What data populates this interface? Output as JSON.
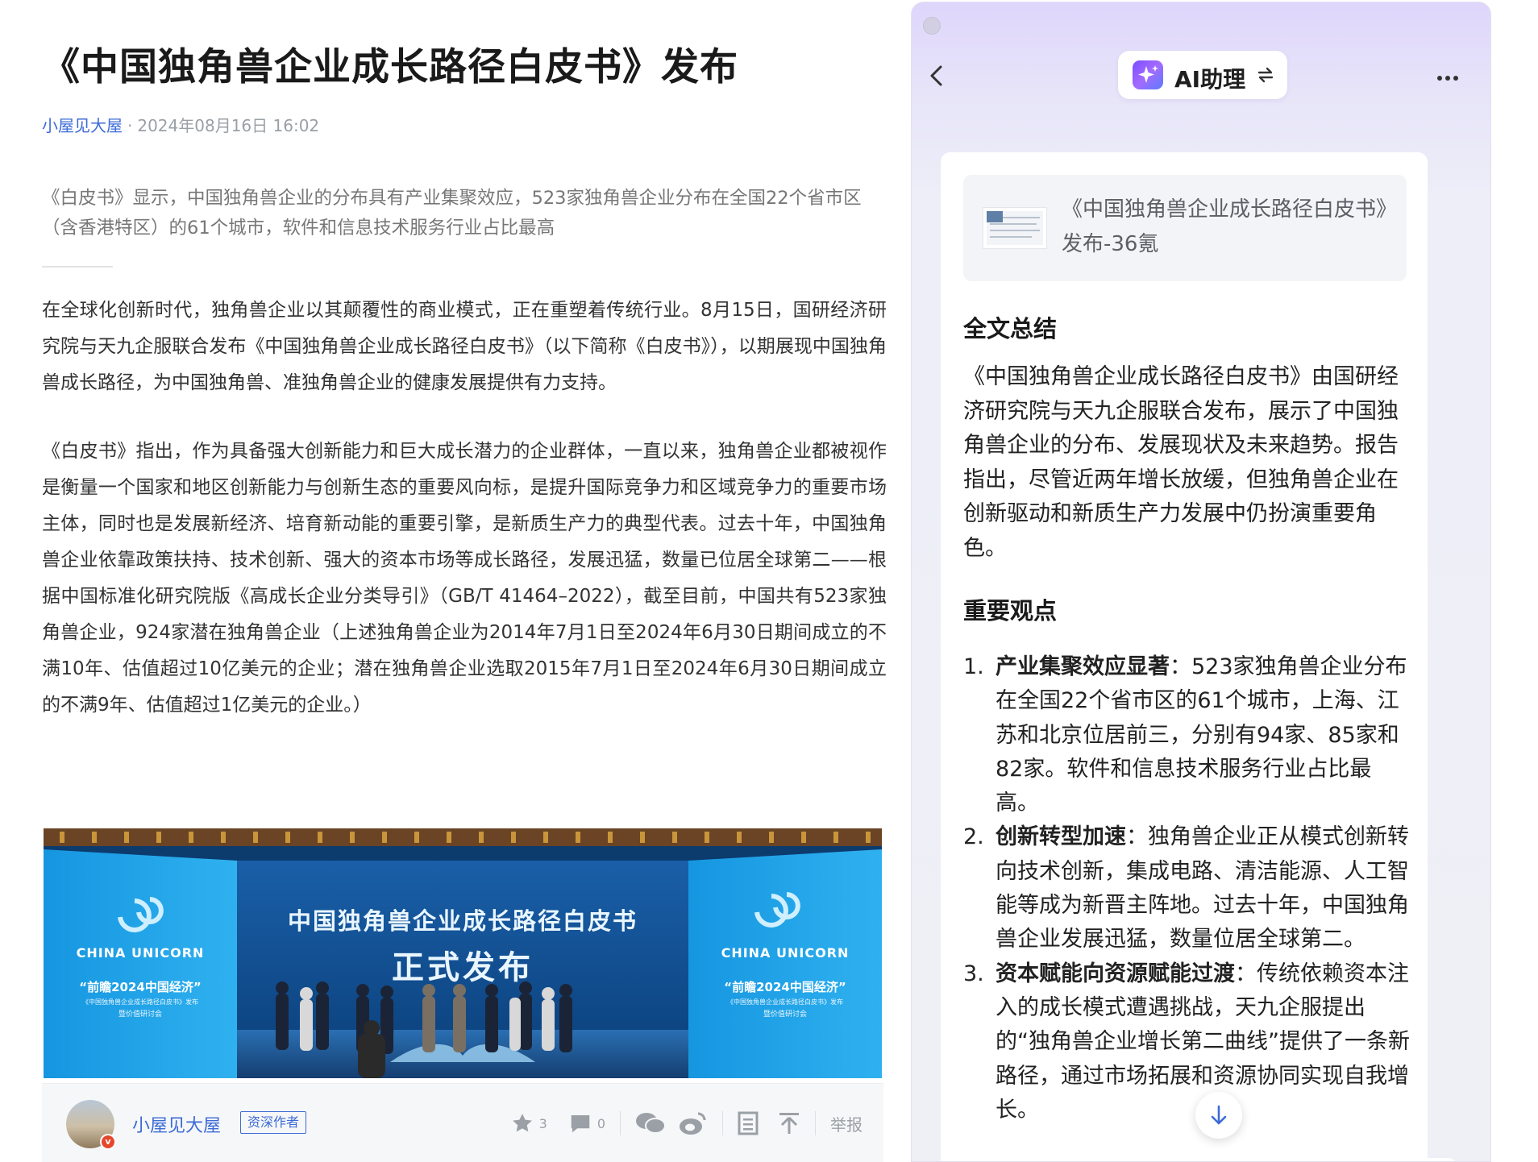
{
  "article": {
    "title": "《中国独角兽企业成长路径白皮书》发布",
    "author": "小屋见大屋",
    "date": "2024年08月16日 16:02",
    "summary": "《白皮书》显示，中国独角兽企业的分布具有产业集聚效应，523家独角兽企业分布在全国22个省市区（含香港特区）的61个城市，软件和信息技术服务行业占比最高",
    "paragraphs": [
      "在全球化创新时代，独角兽企业以其颠覆性的商业模式，正在重塑着传统行业。8月15日，国研经济研究院与天九企服联合发布《中国独角兽企业成长路径白皮书》（以下简称《白皮书》），以期展现中国独角兽成长路径，为中国独角兽、准独角兽企业的健康发展提供有力支持。",
      "《白皮书》指出，作为具备强大创新能力和巨大成长潜力的企业群体，一直以来，独角兽企业都被视作是衡量一个国家和地区创新能力与创新生态的重要风向标，是提升国际竞争力和区域竞争力的重要市场主体，同时也是发展新经济、培育新动能的重要引擎，是新质生产力的典型代表。过去十年，中国独角兽企业依靠政策扶持、技术创新、强大的资本市场等成长路径，发展迅猛，数量已位居全球第二——根据中国标准化研究院版《高成长企业分类导引》（GB/T 41464–2022），截至目前，中国共有523家独角兽企业，924家潜在独角兽企业（上述独角兽企业为2014年7月1日至2024年6月30日期间成立的不满10年、估值超过10亿美元的企业；潜在独角兽企业选取2015年7月1日至2024年6月30日期间成立的不满9年、估值超过1亿美元的企业。）"
    ],
    "photo": {
      "title_line1": "中国独角兽企业成长路径白皮书",
      "title_line2": "正式发布",
      "wing_logo": "CHINA UNICORN",
      "wing_event": "“前瞻2024中国经济”",
      "wing_sub": "《中国独角兽企业成长路径白皮书》发布",
      "wing_sub2": "暨价值研讨会"
    },
    "author_bar": {
      "name": "小屋见大屋",
      "tag": "资深作者",
      "badge": "v",
      "likes": "3",
      "comments": "0",
      "report": "举报"
    }
  },
  "ai_panel": {
    "title": "AI助理",
    "source_title": "《中国独角兽企业成长路径白皮书》发布-36氪",
    "summary_heading": "全文总结",
    "summary": "《中国独角兽企业成长路径白皮书》由国研经济研究院与天九企服联合发布，展示了中国独角兽企业的分布、发展现状及未来趋势。报告指出，尽管近两年增长放缓，但独角兽企业在创新驱动和新质生产力发展中仍扮演重要角色。",
    "points_heading": "重要观点",
    "points": [
      {
        "num": "1.",
        "title": "产业集聚效应显著",
        "text": "：523家独角兽企业分布在全国22个省市区的61个城市，上海、江苏和北京位居前三，分别有94家、85家和82家。软件和信息技术服务行业占比最高。"
      },
      {
        "num": "2.",
        "title": "创新转型加速",
        "text": "：独角兽企业正从模式创新转向技术创新，集成电路、清洁能源、人工智能等成为新晋主阵地。过去十年，中国独角兽企业发展迅猛，数量位居全球第二。"
      },
      {
        "num": "3.",
        "title": "资本赋能向资源赋能过渡",
        "text": "：传统依赖资本注入的成长模式遭遇挑战，天九企服提出的“独角兽企业增长第二曲线”提供了一条新路径，通过市场拓展和资源协同实现自我增长。"
      }
    ]
  },
  "colors": {
    "link": "#3c6bd6",
    "muted": "#9aa0a6",
    "ai_gradient_top": "#ded6fb",
    "ai_accent": "#7b4dff"
  },
  "icons": [
    "chevron-left-icon",
    "ai-sparkle-icon",
    "switch-icon",
    "more-icon",
    "star-icon",
    "comment-icon",
    "wechat-icon",
    "weibo-icon",
    "bookmark-icon",
    "back-to-top-icon",
    "arrow-down-icon"
  ]
}
